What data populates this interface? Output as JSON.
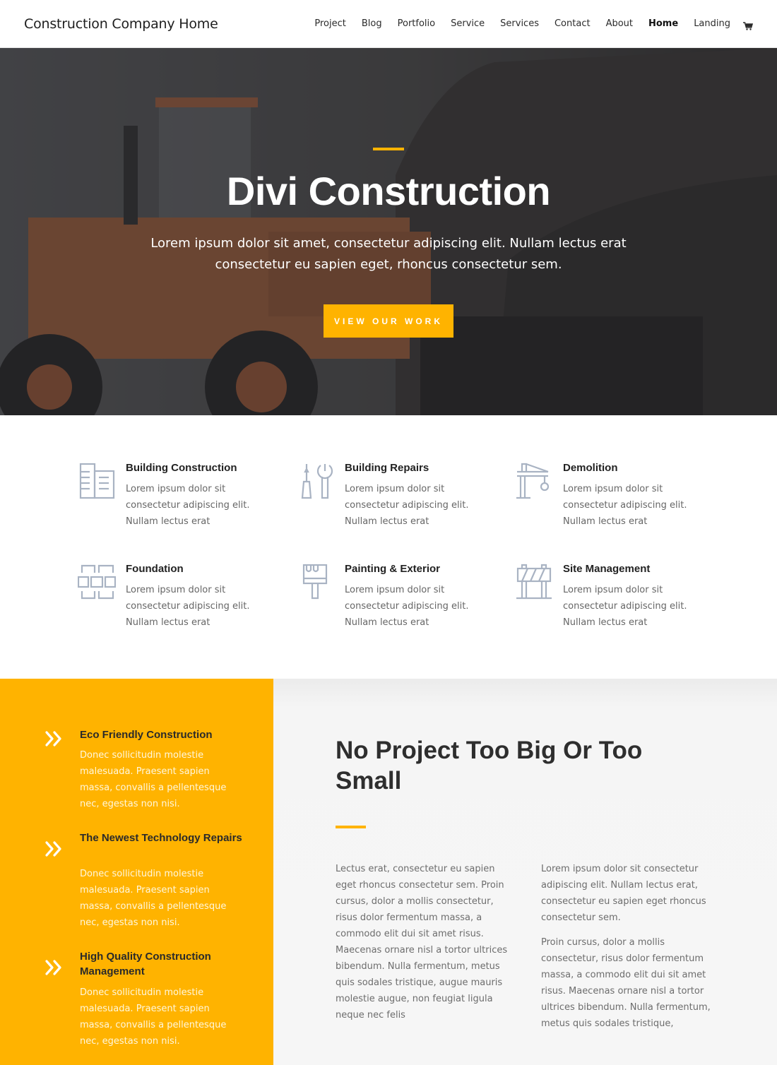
{
  "header": {
    "logo": "Construction Company Home",
    "nav": [
      {
        "label": "Project",
        "active": false
      },
      {
        "label": "Blog",
        "active": false
      },
      {
        "label": "Portfolio",
        "active": false
      },
      {
        "label": "Service",
        "active": false
      },
      {
        "label": "Services",
        "active": false
      },
      {
        "label": "Contact",
        "active": false
      },
      {
        "label": "About",
        "active": false
      },
      {
        "label": "Home",
        "active": true
      },
      {
        "label": "Landing",
        "active": false
      }
    ],
    "cart_icon": "shopping-cart-icon"
  },
  "hero": {
    "title": "Divi Construction",
    "text": "Lorem ipsum dolor sit amet, consectetur adipiscing elit. Nullam lectus erat consectetur eu sapien eget, rhoncus consectetur sem.",
    "button": "VIEW OUR WORK"
  },
  "services": [
    {
      "icon": "buildings-icon",
      "title": "Building Construction",
      "text": "Lorem ipsum dolor sit consectetur adipiscing elit. Nullam lectus erat"
    },
    {
      "icon": "tools-icon",
      "title": "Building Repairs",
      "text": "Lorem ipsum dolor sit consectetur adipiscing elit. Nullam lectus erat"
    },
    {
      "icon": "crane-icon",
      "title": "Demolition",
      "text": "Lorem ipsum dolor sit consectetur adipiscing elit. Nullam lectus erat"
    },
    {
      "icon": "bricks-icon",
      "title": "Foundation",
      "text": "Lorem ipsum dolor sit consectetur adipiscing elit. Nullam lectus erat"
    },
    {
      "icon": "paint-brush-icon",
      "title": "Painting & Exterior",
      "text": "Lorem ipsum dolor sit consectetur adipiscing elit. Nullam lectus erat"
    },
    {
      "icon": "barrier-icon",
      "title": "Site Management",
      "text": "Lorem ipsum dolor sit consectetur adipiscing elit. Nullam lectus erat"
    }
  ],
  "features": [
    {
      "icon": "double-chevron-right-icon",
      "title": "Eco Friendly Construction",
      "text": "Donec sollicitudin molestie malesuada. Praesent sapien massa, convallis a pellentesque nec, egestas non nisi."
    },
    {
      "icon": "double-chevron-right-icon",
      "title": "The Newest Technology Repairs",
      "text": "Donec sollicitudin molestie malesuada. Praesent sapien massa, convallis a pellentesque nec, egestas non nisi."
    },
    {
      "icon": "double-chevron-right-icon",
      "title": "High Quality Construction Management",
      "text": "Donec sollicitudin molestie malesuada. Praesent sapien massa, convallis a pellentesque nec, egestas non nisi."
    }
  ],
  "no_project": {
    "title": "No Project Too Big Or Too Small",
    "col1": [
      "Lectus erat, consectetur eu sapien eget rhoncus consectetur sem. Proin cursus, dolor a mollis consectetur, risus dolor fermentum massa, a commodo elit dui sit amet risus. Maecenas ornare nisl a tortor ultrices bibendum. Nulla fermentum, metus quis sodales tristique, augue mauris molestie augue, non feugiat ligula neque nec felis"
    ],
    "col2": [
      "Lorem ipsum dolor sit consectetur adipiscing elit. Nullam lectus erat, consectetur eu sapien eget rhoncus consectetur sem.",
      "Proin cursus, dolor a mollis consectetur, risus dolor fermentum massa, a commodo elit dui sit amet risus. Maecenas ornare nisl a tortor ultrices bibendum. Nulla fermentum, metus quis sodales tristique,"
    ]
  },
  "colors": {
    "accent": "#ffb300",
    "icon_gray": "#a9b3c3",
    "heading_dark": "#2e2e2e"
  }
}
